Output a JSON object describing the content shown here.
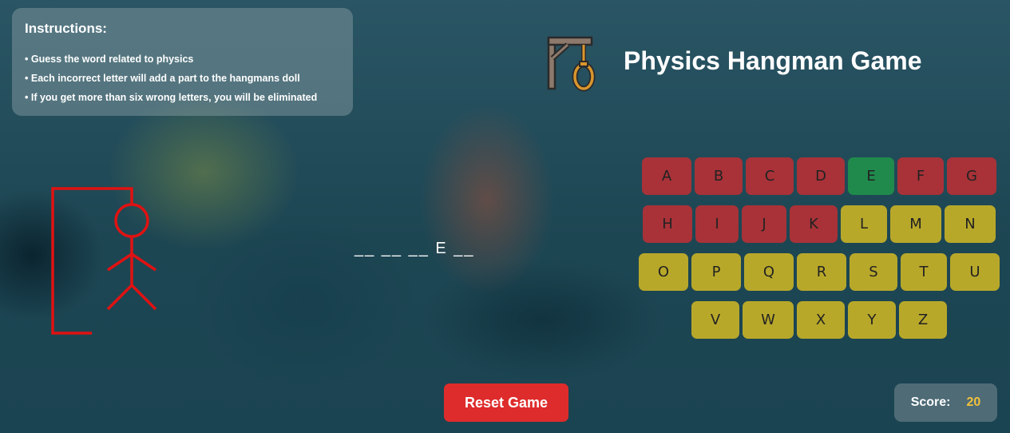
{
  "instructions": {
    "title": "Instructions:",
    "items": [
      "Guess the word related to physics",
      "Each incorrect letter will add a part to the hangmans doll",
      "If you get more than six wrong letters, you will be eliminated"
    ]
  },
  "header": {
    "title": "Physics Hangman Game",
    "logo_icon": "gallows-noose-icon"
  },
  "hangman": {
    "color": "#e01212",
    "parts_shown": [
      "gallows",
      "head",
      "body",
      "left-arm",
      "right-arm",
      "left-leg",
      "right-leg"
    ]
  },
  "word": {
    "display": "__ __ __ E __"
  },
  "keyboard": {
    "rows": [
      [
        {
          "letter": "A",
          "state": "wrong"
        },
        {
          "letter": "B",
          "state": "wrong"
        },
        {
          "letter": "C",
          "state": "wrong"
        },
        {
          "letter": "D",
          "state": "wrong"
        },
        {
          "letter": "E",
          "state": "correct"
        },
        {
          "letter": "F",
          "state": "wrong"
        },
        {
          "letter": "G",
          "state": "wrong"
        }
      ],
      [
        {
          "letter": "H",
          "state": "wrong"
        },
        {
          "letter": "I",
          "state": "wrong"
        },
        {
          "letter": "J",
          "state": "wrong"
        },
        {
          "letter": "K",
          "state": "wrong"
        },
        {
          "letter": "L",
          "state": "available"
        },
        {
          "letter": "M",
          "state": "available"
        },
        {
          "letter": "N",
          "state": "available"
        }
      ],
      [
        {
          "letter": "O",
          "state": "available"
        },
        {
          "letter": "P",
          "state": "available"
        },
        {
          "letter": "Q",
          "state": "available"
        },
        {
          "letter": "R",
          "state": "available"
        },
        {
          "letter": "S",
          "state": "available"
        },
        {
          "letter": "T",
          "state": "available"
        },
        {
          "letter": "U",
          "state": "available"
        }
      ],
      [
        {
          "letter": "V",
          "state": "available"
        },
        {
          "letter": "W",
          "state": "available"
        },
        {
          "letter": "X",
          "state": "available"
        },
        {
          "letter": "Y",
          "state": "available"
        },
        {
          "letter": "Z",
          "state": "available"
        }
      ]
    ],
    "colors": {
      "wrong": "#a83238",
      "correct": "#1f8a4c",
      "available": "#b8a82a"
    }
  },
  "reset_button": {
    "label": "Reset Game",
    "color": "#de2b2b"
  },
  "score": {
    "label": "Score:",
    "value": "20",
    "value_color": "#f2c23b"
  }
}
